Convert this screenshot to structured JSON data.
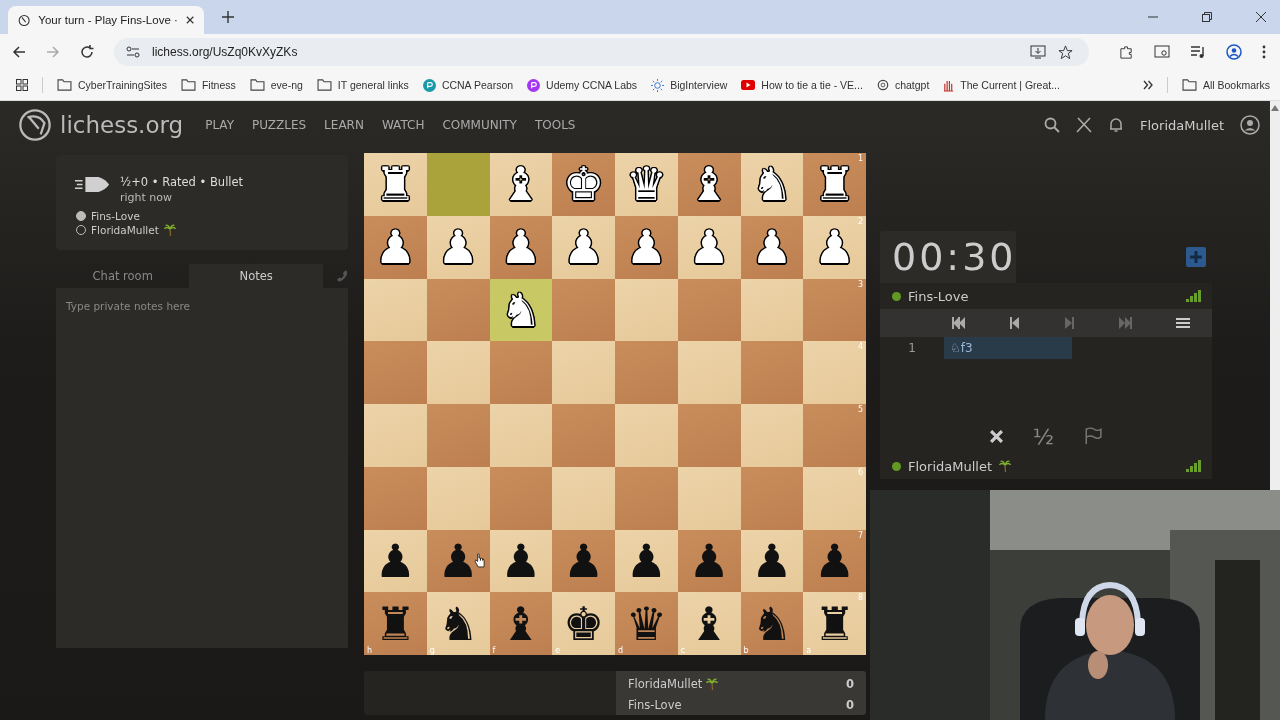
{
  "browser": {
    "tab": {
      "title": "Your turn - Play Fins-Love ·",
      "selected": true
    },
    "url": "lichess.org/UsZq0KvXyZKs",
    "bookmarks": [
      {
        "kind": "folder",
        "label": "CyberTrainingSites"
      },
      {
        "kind": "folder",
        "label": "Fitness"
      },
      {
        "kind": "folder",
        "label": "eve-ng"
      },
      {
        "kind": "folder",
        "label": "IT general links"
      },
      {
        "kind": "pearson",
        "label": "CCNA Pearson"
      },
      {
        "kind": "udemy",
        "label": "Udemy CCNA Labs"
      },
      {
        "kind": "sun",
        "label": "BigInterview"
      },
      {
        "kind": "video",
        "label": "How to tie a tie - VE..."
      },
      {
        "kind": "chatgpt",
        "label": "chatgpt"
      },
      {
        "kind": "current",
        "label": "The Current | Great..."
      }
    ],
    "all_bookmarks": "All Bookmarks"
  },
  "site": {
    "logo": "lichess.org",
    "nav": [
      {
        "label": "PLAY"
      },
      {
        "label": "PUZZLES"
      },
      {
        "label": "LEARN"
      },
      {
        "label": "WATCH"
      },
      {
        "label": "COMMUNITY"
      },
      {
        "label": "TOOLS"
      }
    ],
    "username": "FloridaMullet"
  },
  "game_info": {
    "title": "½+0 • Rated • Bullet",
    "time": "right now",
    "players": [
      {
        "name": "Fins-Love",
        "white": true,
        "palm": false
      },
      {
        "name": "FloridaMullet",
        "white": false,
        "palm": true
      }
    ]
  },
  "tabs": [
    {
      "label": "Chat room",
      "selected": false
    },
    {
      "label": "Notes",
      "selected": true
    }
  ],
  "notes": {
    "placeholder": "Type private notes here"
  },
  "board": {
    "files": [
      "h",
      "g",
      "f",
      "e",
      "d",
      "c",
      "b",
      "a"
    ],
    "ranks": [
      {
        "label": "1",
        "squares": [
          {
            "piece": "♜",
            "white": true,
            "highlight": false
          },
          {
            "highlight": true
          },
          {
            "piece": "♝",
            "white": true,
            "highlight": false
          },
          {
            "piece": "♚",
            "white": true,
            "highlight": false
          },
          {
            "piece": "♛",
            "white": true,
            "highlight": false
          },
          {
            "piece": "♝",
            "white": true,
            "highlight": false
          },
          {
            "piece": "♞",
            "white": true,
            "highlight": false
          },
          {
            "piece": "♜",
            "white": true,
            "highlight": false
          }
        ]
      },
      {
        "label": "2",
        "squares": [
          {
            "piece": "♟",
            "white": true,
            "highlight": false
          },
          {
            "piece": "♟",
            "white": true,
            "highlight": false
          },
          {
            "piece": "♟",
            "white": true,
            "highlight": false
          },
          {
            "piece": "♟",
            "white": true,
            "highlight": false
          },
          {
            "piece": "♟",
            "white": true,
            "highlight": false
          },
          {
            "piece": "♟",
            "white": true,
            "highlight": false
          },
          {
            "piece": "♟",
            "white": true,
            "highlight": false
          },
          {
            "piece": "♟",
            "white": true,
            "highlight": false
          }
        ]
      },
      {
        "label": "3",
        "squares": [
          {
            "highlight": false
          },
          {
            "highlight": false
          },
          {
            "piece": "♞",
            "white": true,
            "highlight": true
          },
          {
            "highlight": false
          },
          {
            "highlight": false
          },
          {
            "highlight": false
          },
          {
            "highlight": false
          },
          {
            "highlight": false
          }
        ]
      },
      {
        "label": "4",
        "squares": [
          {
            "highlight": false
          },
          {
            "highlight": false
          },
          {
            "highlight": false
          },
          {
            "highlight": false
          },
          {
            "highlight": false
          },
          {
            "highlight": false
          },
          {
            "highlight": false
          },
          {
            "highlight": false
          }
        ]
      },
      {
        "label": "5",
        "squares": [
          {
            "highlight": false
          },
          {
            "highlight": false
          },
          {
            "highlight": false
          },
          {
            "highlight": false
          },
          {
            "highlight": false
          },
          {
            "highlight": false
          },
          {
            "highlight": false
          },
          {
            "highlight": false
          }
        ]
      },
      {
        "label": "6",
        "squares": [
          {
            "highlight": false
          },
          {
            "highlight": false
          },
          {
            "highlight": false
          },
          {
            "highlight": false
          },
          {
            "highlight": false
          },
          {
            "highlight": false
          },
          {
            "highlight": false
          },
          {
            "highlight": false
          }
        ]
      },
      {
        "label": "7",
        "squares": [
          {
            "piece": "♟",
            "white": false,
            "highlight": false
          },
          {
            "piece": "♟",
            "white": false,
            "highlight": false
          },
          {
            "piece": "♟",
            "white": false,
            "highlight": false
          },
          {
            "piece": "♟",
            "white": false,
            "highlight": false
          },
          {
            "piece": "♟",
            "white": false,
            "highlight": false
          },
          {
            "piece": "♟",
            "white": false,
            "highlight": false
          },
          {
            "piece": "♟",
            "white": false,
            "highlight": false
          },
          {
            "piece": "♟",
            "white": false,
            "highlight": false
          }
        ]
      },
      {
        "label": "8",
        "squares": [
          {
            "piece": "♜",
            "white": false,
            "highlight": false
          },
          {
            "piece": "♞",
            "white": false,
            "highlight": false
          },
          {
            "piece": "♝",
            "white": false,
            "highlight": false
          },
          {
            "piece": "♚",
            "white": false,
            "highlight": false
          },
          {
            "piece": "♛",
            "white": false,
            "highlight": false
          },
          {
            "piece": "♝",
            "white": false,
            "highlight": false
          },
          {
            "piece": "♞",
            "white": false,
            "highlight": false
          },
          {
            "piece": "♜",
            "white": false,
            "highlight": false
          }
        ]
      }
    ]
  },
  "clock": "00:30",
  "opponent": {
    "name": "Fins-Love",
    "online": true,
    "palm": false
  },
  "moves": [
    {
      "number": "1",
      "white": "♘f3",
      "selected": true
    }
  ],
  "draw_offer": "½",
  "player": {
    "name": "FloridaMullet",
    "online": true,
    "palm": true
  },
  "scores": [
    {
      "name": "FloridaMullet",
      "palm": true,
      "score": "0"
    },
    {
      "name": "Fins-Love",
      "palm": false,
      "score": "0"
    }
  ]
}
